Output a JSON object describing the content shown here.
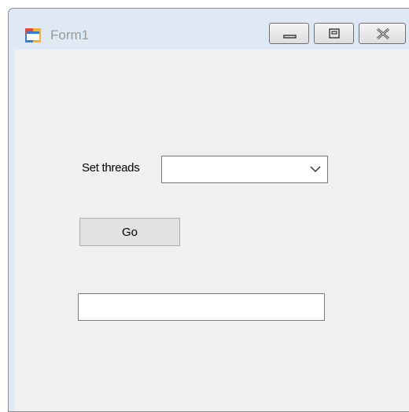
{
  "window": {
    "title": "Form1",
    "controls": {
      "minimize_icon": "minimize-icon",
      "maximize_icon": "maximize-icon",
      "close_icon": "close-icon"
    }
  },
  "form": {
    "threads_label": "Set threads",
    "threads_value": "",
    "go_label": "Go",
    "output_value": ""
  },
  "colors": {
    "title_text": "#9a9a9a",
    "client_background": "#f0f0f0",
    "frame": "#dfe9f5",
    "button_face": "#e1e1e1"
  }
}
